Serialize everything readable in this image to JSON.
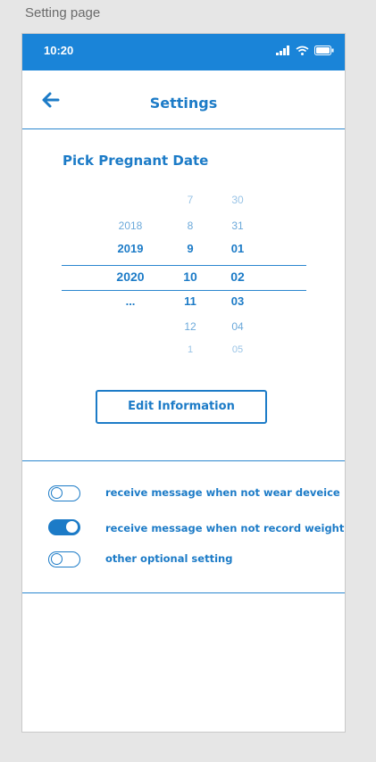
{
  "caption": "Setting page",
  "status_bar": {
    "time": "10:20",
    "background": "#1a84d8"
  },
  "header": {
    "title": "Settings",
    "back_icon": "arrow-left-icon"
  },
  "pregnant_date": {
    "label": "Pick Pregnant Date",
    "years": [
      "2018",
      "2019",
      "2020",
      "..."
    ],
    "months": [
      "7",
      "8",
      "9",
      "10",
      "11",
      "12",
      "1"
    ],
    "days": [
      "30",
      "31",
      "01",
      "02",
      "03",
      "04",
      "05"
    ],
    "selected": {
      "year": "2020",
      "month": "10",
      "day": "02"
    }
  },
  "edit_button": {
    "label": "Edit Information"
  },
  "settings_toggles": [
    {
      "label": "receive message when not wear deveice",
      "on": false
    },
    {
      "label": "receive message when not record weight",
      "on": true
    },
    {
      "label": "other optional setting",
      "on": false
    }
  ],
  "colors": {
    "accent": "#1c7bc7",
    "statusbar": "#1a84d8"
  }
}
